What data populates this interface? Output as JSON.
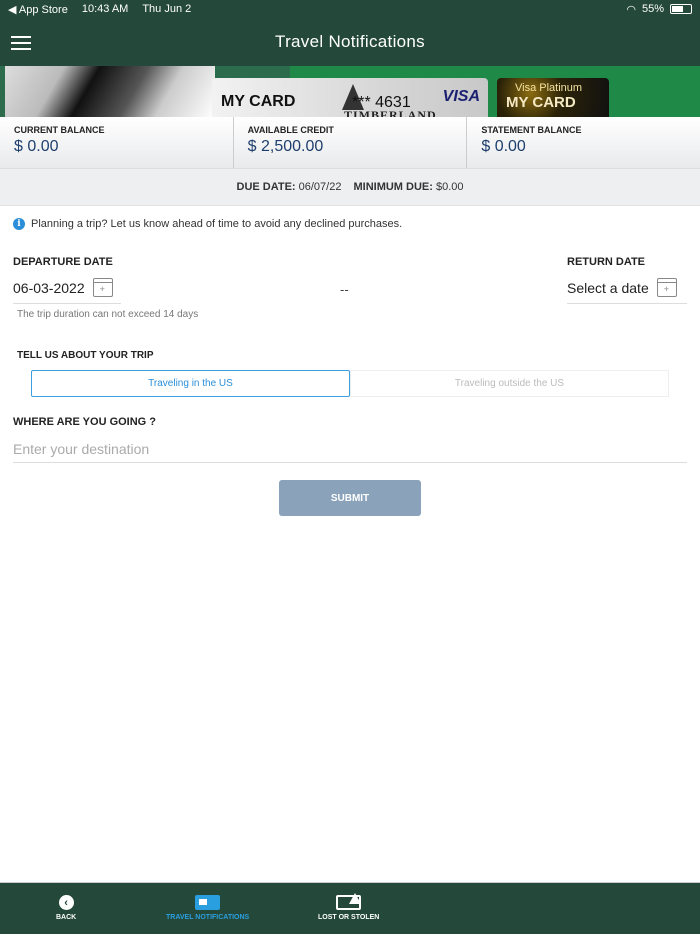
{
  "status_bar": {
    "back_app": "◀ App Store",
    "time": "10:43 AM",
    "date": "Thu Jun 2",
    "battery": "55%"
  },
  "header": {
    "title": "Travel Notifications"
  },
  "cards": {
    "primary": {
      "name": "MY CARD",
      "number": "*** 4631",
      "network": "VISA",
      "brand": "TIMBERLAND"
    },
    "secondary": {
      "subtitle": "Visa Platinum",
      "name": "MY CARD"
    }
  },
  "balances": [
    {
      "label": "CURRENT BALANCE",
      "value": "$ 0.00"
    },
    {
      "label": "AVAILABLE CREDIT",
      "value": "$ 2,500.00"
    },
    {
      "label": "STATEMENT BALANCE",
      "value": "$ 0.00"
    }
  ],
  "due": {
    "due_label": "DUE DATE:",
    "due_value": "06/07/22",
    "min_label": "MINIMUM DUE:",
    "min_value": "$0.00"
  },
  "info_text": "Planning a trip? Let us know ahead of time to avoid any declined purchases.",
  "form": {
    "departure_label": "DEPARTURE DATE",
    "departure_value": "06-03-2022",
    "separator": "--",
    "return_label": "RETURN DATE",
    "return_value": "Select a date",
    "duration_hint": "The trip duration can not exceed 14 days",
    "trip_label": "TELL US ABOUT YOUR TRIP",
    "trip_options": [
      "Traveling in the US",
      "Traveling outside the US"
    ],
    "destination_label": "WHERE ARE YOU GOING ?",
    "destination_placeholder": "Enter your destination",
    "submit_label": "SUBMIT"
  },
  "tabs": [
    {
      "label": "BACK",
      "icon": "back-icon"
    },
    {
      "label": "TRAVEL NOTIFICATIONS",
      "icon": "travel-icon"
    },
    {
      "label": "LOST OR STOLEN",
      "icon": "lost-stolen-icon"
    }
  ],
  "colors": {
    "header_bg": "#24493a",
    "accent": "#2a8fd8",
    "submit_bg": "#8aa3bb",
    "balance_text": "#1e3f6d"
  }
}
